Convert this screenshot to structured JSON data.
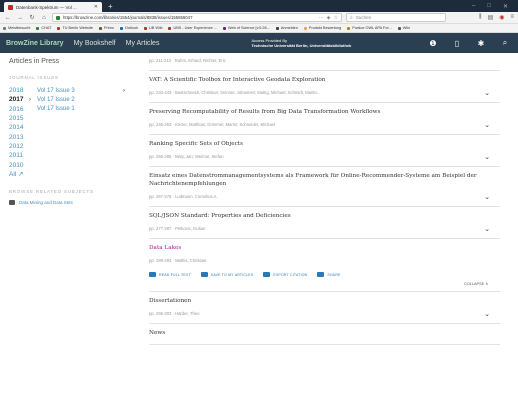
{
  "browser": {
    "tab_title": "Datenbank-Spektrum — Vol ...",
    "tab_new": "+",
    "url": "https://browzine.com/libraries/1554/journals/8838/issues/155656047",
    "search_placeholder": "Suchen",
    "bookmarks": [
      {
        "label": "Meistbesucht",
        "color": "#607d8b"
      },
      {
        "label": "CHAT",
        "color": "#2e7d32"
      },
      {
        "label": "TU Berlin Website",
        "color": "#c62828"
      },
      {
        "label": "Primo",
        "color": "#c62828"
      },
      {
        "label": "Outlook",
        "color": "#1565c0"
      },
      {
        "label": "UB Wiki",
        "color": "#c62828"
      },
      {
        "label": "UBS - User Experience ...",
        "color": "#c62828"
      },
      {
        "label": "Web of Science [v.5.28...",
        "color": "#6a1b9a"
      },
      {
        "label": "Anmelden",
        "color": "#424242"
      },
      {
        "label": "Produkt Bewertung",
        "color": "#f9a825"
      },
      {
        "label": "Purdue OWL APA For...",
        "color": "#b8860b"
      },
      {
        "label": "Wiki",
        "color": "#555555"
      }
    ]
  },
  "header": {
    "brand": "BrowZine Library",
    "nav_bookshelf": "My Bookshelf",
    "nav_articles": "My Articles",
    "access_line1": "Access Provided By",
    "access_line2": "Technische Universität Berlin, Universitätsbibliothek"
  },
  "sidebar": {
    "articles_in_press": "Articles in Press",
    "journal_issues": "JOURNAL ISSUES",
    "years": [
      {
        "year": "2018",
        "active": false,
        "chev": ""
      },
      {
        "year": "2017",
        "active": true,
        "chev": "›"
      },
      {
        "year": "2016",
        "active": false,
        "chev": ""
      },
      {
        "year": "2015",
        "active": false,
        "chev": ""
      },
      {
        "year": "2014",
        "active": false,
        "chev": ""
      },
      {
        "year": "2013",
        "active": false,
        "chev": ""
      },
      {
        "year": "2012",
        "active": false,
        "chev": ""
      },
      {
        "year": "2011",
        "active": false,
        "chev": ""
      },
      {
        "year": "2010",
        "active": false,
        "chev": ""
      },
      {
        "year": "All ↗",
        "active": false,
        "chev": ""
      }
    ],
    "volumes": [
      "Vol 17 Issue 3",
      "Vol 17 Issue 2",
      "Vol 17 Issue 1"
    ],
    "browse_related": "BROWSE RELATED SUBJECTS",
    "subject": "Data Mining and Data Sets"
  },
  "articles": [
    {
      "title": "",
      "meta": "pp. 211-212 · Rahm, Erhard, Richter, Eric",
      "active": false
    },
    {
      "title": "VAT: A Scientific Toolbox for Interactive Geodata Exploration",
      "meta": "pp. 233-243 · Bastschneidt, Christian; Sninner, Johannes; Mattig, Michael; Schmidt, Martin...",
      "active": false
    },
    {
      "title": "Preserving Recomputability of Results from Big Data Transformation Workflows",
      "meta": "pp. 245-253 · Kricke, Matthias; Grimmer, Martin; Schneider, Michael",
      "active": false
    },
    {
      "title": "Ranking Specific Sets of Objects",
      "meta": "pp. 255-265 · Maiy, Jan; Weimar, Stefan",
      "active": false
    },
    {
      "title": "Einsatz eines Datenstrommanagementsystems als Framework für Online-Recommender-Systeme am Beispiel der Nachrichtenempfehlungen",
      "meta": "pp. 267-276 · Ludmann, Cornelius A.",
      "active": false
    },
    {
      "title": "SQL/JSON Standard: Properties and Deficiencies",
      "meta": "pp. 277-287 · Petkovic, Dušan",
      "active": false
    },
    {
      "title": "Data Lakes",
      "meta": "pp. 289-293 · Mathis, Christian",
      "active": true,
      "expanded": true
    },
    {
      "title": "Dissertationen",
      "meta": "pp. 295-303 · Härder, Theo",
      "active": false
    },
    {
      "title": "News",
      "meta": "",
      "active": false
    }
  ],
  "actions": {
    "read": "READ FULL TEXT",
    "save": "SAVE TO MY ARTICLES",
    "export": "EXPORT CITATION",
    "share": "SHARE",
    "collapse": "COLLAPSE ∧"
  },
  "colors": {
    "header_bg": "#2a3f52",
    "brand": "#a8d8b9",
    "link": "#4a8fc1",
    "active_article": "#b0158a",
    "action": "#2a79b7"
  }
}
